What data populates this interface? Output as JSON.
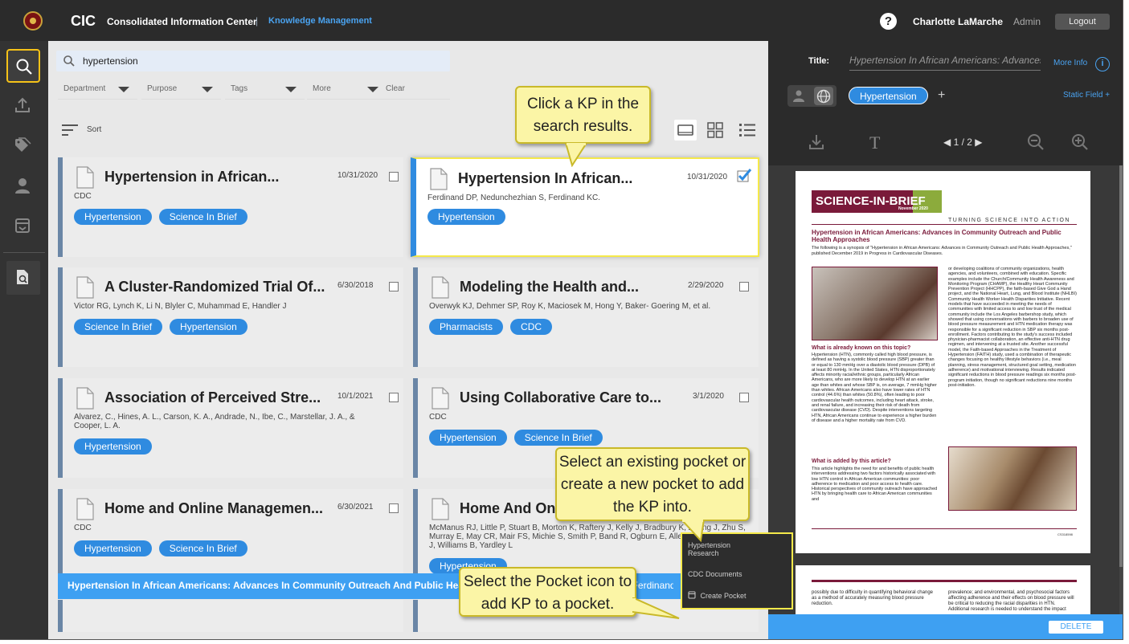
{
  "header": {
    "brand": "CIC",
    "brand_full": "Consolidated Information Center",
    "separator": "|",
    "module": "Knowledge Management",
    "help": "?",
    "user_name": "Charlotte LaMarche",
    "role": "Admin",
    "logout": "Logout"
  },
  "sidebar": {
    "items": [
      "search-icon",
      "upload-icon",
      "tag-icon",
      "user-icon",
      "pocket-icon",
      "document-search-icon"
    ]
  },
  "search": {
    "query": "hypertension",
    "filters": {
      "department": "Department",
      "purpose": "Purpose",
      "tags": "Tags",
      "more": "More",
      "clear": "Clear"
    },
    "sort_label": "Sort"
  },
  "cards": [
    {
      "title": "Hypertension in African...",
      "date": "10/31/2020",
      "authors": "CDC",
      "tags": [
        "Hypertension",
        "Science In Brief"
      ],
      "checked": false
    },
    {
      "title": "Hypertension In African...",
      "date": "10/31/2020",
      "authors": "Ferdinand DP, Nedunchezhian S, Ferdinand KC.",
      "tags": [
        "Hypertension"
      ],
      "checked": true
    },
    {
      "title": "A Cluster-Randomized Trial Of...",
      "date": "6/30/2018",
      "authors": "Victor RG, Lynch K, Li N, Blyler C, Muhammad E, Handler J",
      "tags": [
        "Science In Brief",
        "Hypertension"
      ],
      "checked": false
    },
    {
      "title": "Modeling the Health and...",
      "date": "2/29/2020",
      "authors": "Overwyk KJ, Dehmer SP, Roy K, Maciosek M, Hong Y, Baker- Goering M, et al.",
      "tags": [
        "Pharmacists",
        "CDC"
      ],
      "checked": false
    },
    {
      "title": "Association of Perceived Stre...",
      "date": "10/1/2021",
      "authors": "Alvarez, C., Hines, A. L., Carson, K. A., Andrade, N., Ibe, C., Marstellar, J. A., & Cooper, L. A.",
      "tags": [
        "Hypertension"
      ],
      "checked": false
    },
    {
      "title": "Using Collaborative Care to...",
      "date": "3/1/2020",
      "authors": "CDC",
      "tags": [
        "Hypertension",
        "Science In Brief"
      ],
      "checked": false
    },
    {
      "title": "Home and Online Managemen...",
      "date": "6/30/2021",
      "authors": "CDC",
      "tags": [
        "Hypertension",
        "Science In Brief"
      ],
      "checked": false
    },
    {
      "title": "Home And Onl",
      "date": "",
      "authors": "McManus RJ, Little P, Stuart B, Morton K, Raftery J, Kelly J, Bradbury K, Zhang J, Zhu S, Murray E, May CR, Mair FS, Michie S, Smith P, Band R, Ogburn E, Allen J, Rice C, Nuttall J, Williams B, Yardley L",
      "tags": [
        "Hypertension"
      ],
      "checked": false
    }
  ],
  "bottom_bar": {
    "title": "Hypertension In African Americans: Advances In Community Outreach And Public Health Approaches",
    "authors": "Ferdinand DP, Nedunchezhian S, Ferdinand KC.",
    "delete": "DELETE"
  },
  "detail": {
    "title_label": "Title:",
    "title_value": "Hypertension In African Americans: Advances In Community Outreach And Public Health Approaches",
    "more_info": "More Info",
    "info": "i",
    "topic": "Hypertension",
    "add_topic": "+",
    "static_field": "Static Field +",
    "text_tool": "T",
    "page_indicator": "1 / 2"
  },
  "pdf": {
    "banner": "SCIENCE-IN-BRIEF",
    "banner_date": "November 2020",
    "tagline": "TURNING SCIENCE INTO ACTION",
    "heading": "Hypertension in African Americans: Advances in Community Outreach and Public Health Approaches",
    "intro": "The following is a synopsis of \"Hypertension in African Americans: Advances in Community Outreach and Public Health Approaches,\" published December 2019 in Progress in Cardiovascular Diseases.",
    "right_col": "or developing coalitions of community organizations, health agencies, and volunteers, combined with education. Specific examples include the Church/Community Health Awareness and Monitoring Program (CHAMP), the Healthy Heart Community Prevention Project (HHCPP), the faith-based Give God a Hand project, and the National Heart, Lung, and Blood Institute (NHLBI) Community Health Worker Health Disparities Initiative. Recent models that have succeeded in meeting the needs of communities with limited access to and low trust of the medical community include the Los Angeles barbershop study, which showed that using conversations with barbers to broaden use of blood pressure measurement and HTN medication therapy was responsible for a significant reduction in SBP six months post-enrollment. Factors contributing to the study's success included physician-pharmacist collaboration, an effective anti-HTN drug regimen, and intervening at a trusted site. Another successful model, the Faith-based Approaches in the Treatment of Hypertension (FAITH) study, used a combination of therapeutic changes focusing on healthy lifestyle behaviors (i.e., meal planning, stress management, structured goal setting, medication adherence) and motivational interviewing. Results indicated significant reductions in blood pressure readings six months post-program initiation, though no significant reductions nine months post-initiation.",
    "h2": "What is already known on this topic?",
    "left_col": "Hypertension (HTN), commonly called high blood pressure, is defined as having a systolic blood pressure (SBP) greater than or equal to 130 mmHg over a diastolic blood pressure (DPB) of at least 80 mmHg. In the United States, HTN disproportionately affects minority racial/ethnic groups, particularly African Americans, who are more likely to develop HTN at an earlier age than whites and whose SBP is, on average, 7 mmHg higher than whites. African Americans also have lower rates of HTN control (44.6%) than whites (50.8%), often leading to poor cardiovascular health outcomes, including heart attack, stroke, and renal failure, and increasing their risk of death from cardiovascular disease (CVD). Despite interventions targeting HTN, African Americans continue to experience a higher burden of disease and a higher mortality rate from CVD.",
    "h3": "What is added by this article?",
    "left_col2": "This article highlights the need for and benefits of public health interventions addressing two factors historically associated with low HTN control in African American communities: poor adherence to medication and poor access to health care. Historical perspectives of community outreach have approached HTN by bringing health care to African American communities and",
    "footer": "CS318598",
    "p2_left": "possibly due to difficulty in quantifying behavioral change as a method of accurately measuring blood pressure reduction.",
    "p2_right": "prevalence; and environmental, and psychosocial factors affecting adherence and their effects on blood pressure will be critical to reducing the racial disparities in HTN. Additional research is needed to understand the impact"
  },
  "pocket_menu": {
    "items": [
      "Hypertension Research",
      "CDC Documents"
    ],
    "create": "Create Pocket"
  },
  "callouts": {
    "c1": "Click a KP in the search results.",
    "c2": "Select an existing pocket or create a new pocket to add the KP into.",
    "c3": "Select the Pocket icon to add KP to a pocket."
  },
  "colors": {
    "accent": "#2f8be0",
    "highlight": "#f5e94a",
    "callout_bg": "#fbf5a6",
    "brand_maroon": "#7a1a3a"
  }
}
